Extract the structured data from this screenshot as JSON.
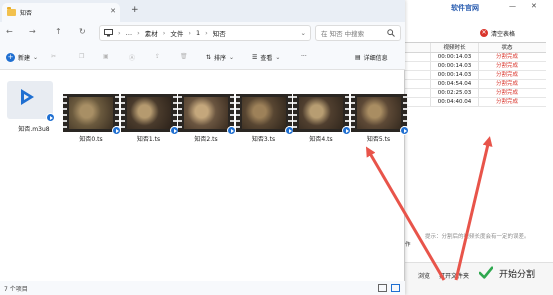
{
  "bg_app": {
    "brand": "软件官网",
    "clear_label": "清空表格",
    "col_duration": "视频时长",
    "col_status": "状态",
    "rows": [
      {
        "duration": "00:00:14.03",
        "status": "分割完成"
      },
      {
        "duration": "00:00:14.03",
        "status": "分割完成"
      },
      {
        "duration": "00:00:14.03",
        "status": "分割完成"
      },
      {
        "duration": "00:04:54.04",
        "status": "分割完成"
      },
      {
        "duration": "00:02:25.03",
        "status": "分割完成"
      },
      {
        "duration": "00:04:40.04",
        "status": "分割完成"
      }
    ],
    "hint": "提示：分割后的视频长度会有一定的误差。",
    "left_char": "作",
    "browse_label": "浏览",
    "open_folder_label": "打开文件夹",
    "start_label": "开始分割"
  },
  "explorer": {
    "tab_title": "知否",
    "address": {
      "more": "…",
      "crumbs": [
        "素材",
        "文件",
        "1",
        "知否"
      ]
    },
    "search_placeholder": "在 知否 中搜索",
    "toolbar": {
      "new_label": "新建",
      "sort_label": "排序",
      "view_label": "查看",
      "more_label": "···",
      "details_label": "详细信息"
    },
    "files": [
      {
        "name": "知否.m3u8",
        "type": "playlist"
      },
      {
        "name": "知否0.ts",
        "type": "video"
      },
      {
        "name": "知否1.ts",
        "type": "video"
      },
      {
        "name": "知否2.ts",
        "type": "video"
      },
      {
        "name": "知否3.ts",
        "type": "video"
      },
      {
        "name": "知否4.ts",
        "type": "video"
      },
      {
        "name": "知否5.ts",
        "type": "video"
      }
    ],
    "status_count": "7 个项目"
  },
  "colors": {
    "accent": "#1f6fd1",
    "arrow": "#e8544a",
    "folder": "#f2c14e",
    "status_done": "#d9342b"
  }
}
